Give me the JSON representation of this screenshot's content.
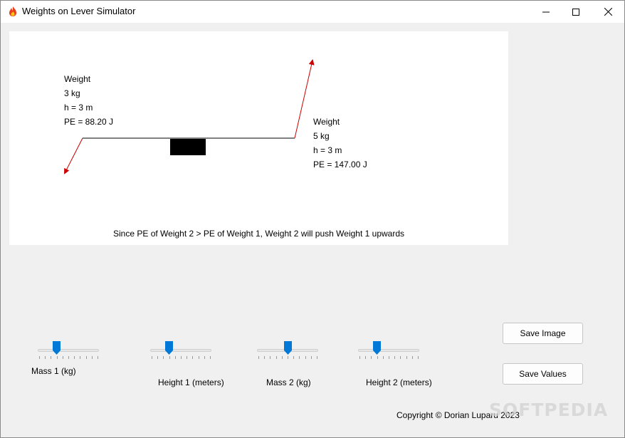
{
  "window": {
    "title": "Weights on Lever Simulator",
    "icon": "flame-icon"
  },
  "simulation": {
    "weight1": {
      "title": "Weight",
      "mass": "3 kg",
      "height": "h = 3 m",
      "pe": "PE = 88.20 J"
    },
    "weight2": {
      "title": "Weight",
      "mass": "5 kg",
      "height": "h = 3 m",
      "pe": "PE = 147.00 J"
    },
    "conclusion": "Since PE of Weight 2 > PE of Weight 1, Weight 2 will push Weight 1 upwards",
    "arrow_color": "#cc0000",
    "lever_color": "#000000"
  },
  "sliders": [
    {
      "label": "Mass 1 (kg)",
      "value": 3,
      "min": 0,
      "max": 10
    },
    {
      "label": "Height 1 (meters)",
      "value": 3,
      "min": 0,
      "max": 10
    },
    {
      "label": "Mass 2 (kg)",
      "value": 5,
      "min": 0,
      "max": 10
    },
    {
      "label": "Height 2 (meters)",
      "value": 3,
      "min": 0,
      "max": 10
    }
  ],
  "buttons": {
    "save_image": "Save Image",
    "save_values": "Save Values"
  },
  "footer": {
    "copyright": "Copyright ©  Dorian Luparu 2023"
  },
  "watermark": "SOFTPEDIA",
  "accent_color": "#0078d7"
}
